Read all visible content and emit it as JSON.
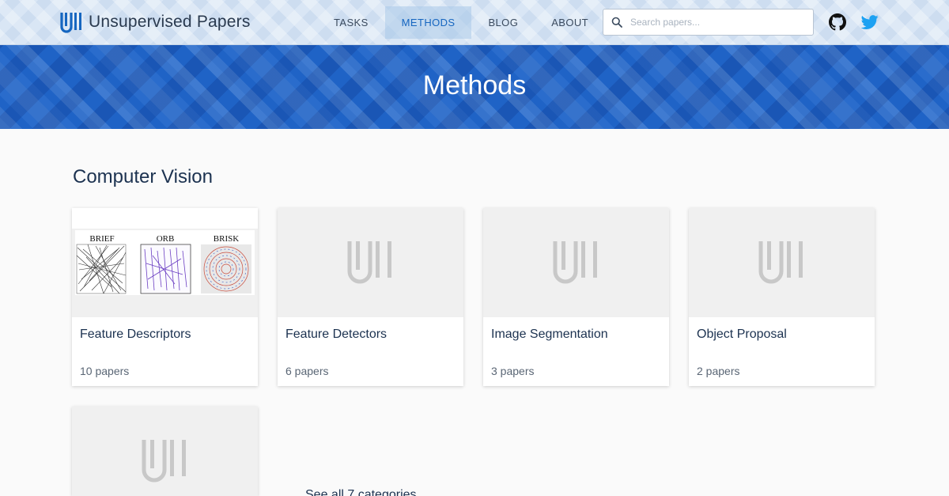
{
  "brand": {
    "name": "Unsupervised Papers",
    "logo_icon": "unsupervised-papers-logo-icon"
  },
  "nav": {
    "items": [
      {
        "label": "TASKS",
        "active": false
      },
      {
        "label": "METHODS",
        "active": true
      },
      {
        "label": "BLOG",
        "active": false
      },
      {
        "label": "ABOUT",
        "active": false
      }
    ]
  },
  "search": {
    "placeholder": "Search papers...",
    "value": "",
    "icon": "search-icon"
  },
  "social": {
    "github_icon": "github-icon",
    "twitter_icon": "twitter-icon"
  },
  "hero": {
    "title": "Methods"
  },
  "section": {
    "title": "Computer Vision",
    "cards": [
      {
        "title": "Feature Descriptors",
        "count": "10 papers",
        "image": "descriptor-comparison-figure",
        "figure_labels": [
          "BRIEF",
          "ORB",
          "BRISK"
        ]
      },
      {
        "title": "Feature Detectors",
        "count": "6 papers",
        "image": "placeholder-logo"
      },
      {
        "title": "Image Segmentation",
        "count": "3 papers",
        "image": "placeholder-logo"
      },
      {
        "title": "Object Proposal",
        "count": "2 papers",
        "image": "placeholder-logo"
      },
      {
        "title": "",
        "count": "",
        "image": "placeholder-logo"
      }
    ],
    "see_all": "See all 7 categories"
  },
  "colors": {
    "brand_blue": "#1666c0",
    "hero_blue": "#1f63c6",
    "text_dark": "#1c3250",
    "placeholder_gray": "#c8c8c8",
    "twitter_blue": "#1da1f2"
  }
}
